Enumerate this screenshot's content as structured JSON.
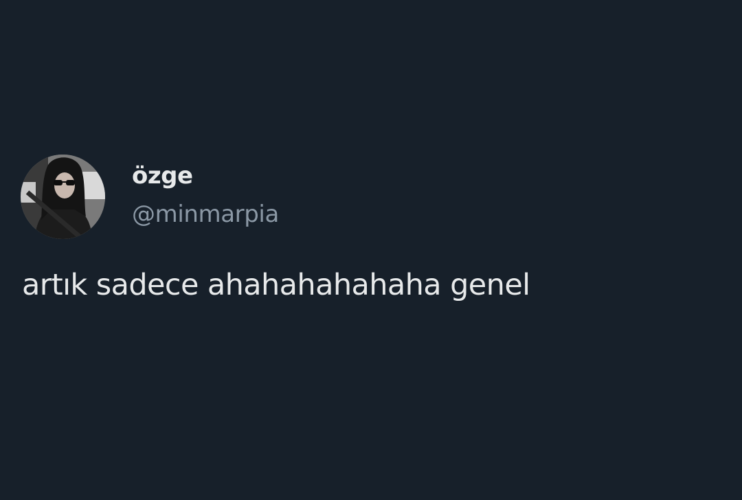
{
  "tweet": {
    "display_name": "özge",
    "handle": "@minmarpia",
    "text": "artık sadece ahahahahahaha genel",
    "avatar_icon": "avatar-photo"
  },
  "colors": {
    "background": "#17202a",
    "primary_text": "#e7e9ea",
    "secondary_text": "#8b98a5"
  }
}
